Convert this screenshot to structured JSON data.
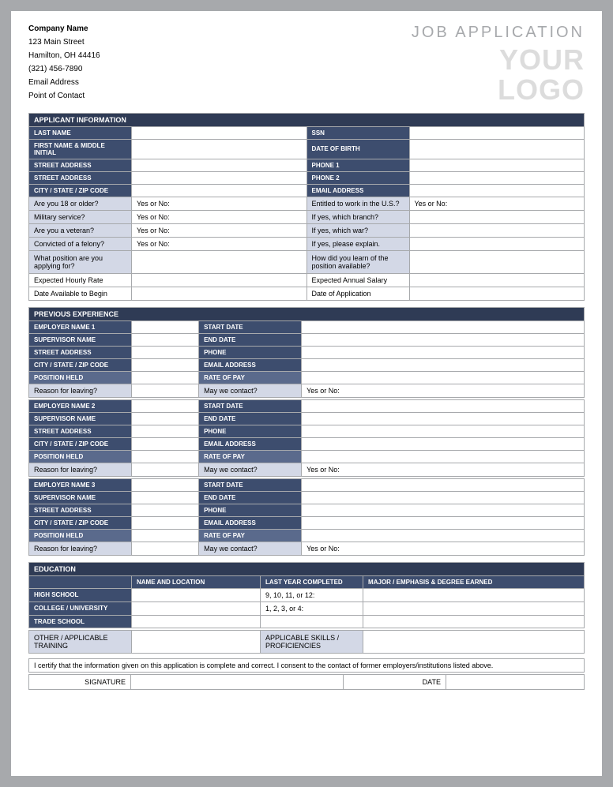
{
  "company": {
    "name": "Company Name",
    "street": "123 Main Street",
    "city": "Hamilton, OH 44416",
    "phone": "(321) 456-7890",
    "email": "Email Address",
    "contact": "Point of Contact"
  },
  "page_title": "JOB APPLICATION",
  "logo_line1": "YOUR",
  "logo_line2": "LOGO",
  "s1": {
    "header": "APPLICANT INFORMATION",
    "last_name": "LAST NAME",
    "ssn": "SSN",
    "first_mi": "FIRST NAME & MIDDLE INITIAL",
    "dob": "DATE OF BIRTH",
    "street1": "STREET ADDRESS",
    "phone1": "PHONE 1",
    "street2": "STREET ADDRESS",
    "phone2": "PHONE 2",
    "csz": "CITY / STATE / ZIP CODE",
    "email": "EMAIL ADDRESS",
    "q_18": "Are you 18 or older?",
    "yesno": "Yes or No:",
    "q_us": "Entitled to work in the U.S.?",
    "q_mil": "Military service?",
    "q_branch": "If yes, which branch?",
    "q_vet": "Are you a veteran?",
    "q_war": "If yes, which war?",
    "q_felony": "Convicted of a felony?",
    "q_explain": "If yes, please explain.",
    "q_position": "What position are you applying for?",
    "q_learn": "How did you learn of the position available?",
    "hourly": "Expected Hourly Rate",
    "annual": "Expected Annual Salary",
    "date_avail": "Date Available to Begin",
    "date_app": "Date of Application"
  },
  "s2": {
    "header": "PREVIOUS EXPERIENCE",
    "emp1": "EMPLOYER NAME 1",
    "emp2": "EMPLOYER NAME 2",
    "emp3": "EMPLOYER NAME 3",
    "sup": "SUPERVISOR NAME",
    "street": "STREET ADDRESS",
    "csz": "CITY / STATE / ZIP CODE",
    "pos": "POSITION HELD",
    "start": "START DATE",
    "end": "END DATE",
    "phone": "PHONE",
    "email": "EMAIL ADDRESS",
    "rate": "RATE OF PAY",
    "reason": "Reason for leaving?",
    "contact": "May we contact?",
    "yesno": "Yes or No:"
  },
  "s3": {
    "header": "EDUCATION",
    "col_name": "NAME AND LOCATION",
    "col_year": "LAST YEAR COMPLETED",
    "col_major": "MAJOR / EMPHASIS & DEGREE EARNED",
    "hs": "HIGH SCHOOL",
    "hs_year": "9, 10, 11, or 12:",
    "col": "COLLEGE / UNIVERSITY",
    "col_year_v": "1, 2, 3, or 4:",
    "trade": "TRADE SCHOOL",
    "other": "OTHER / APPLICABLE TRAINING",
    "skills": "APPLICABLE SKILLS / PROFICIENCIES"
  },
  "cert": "I certify that the information given on this application is complete and correct. I consent to the contact of former employers/institutions  listed above.",
  "sig": "SIGNATURE",
  "date": "DATE"
}
